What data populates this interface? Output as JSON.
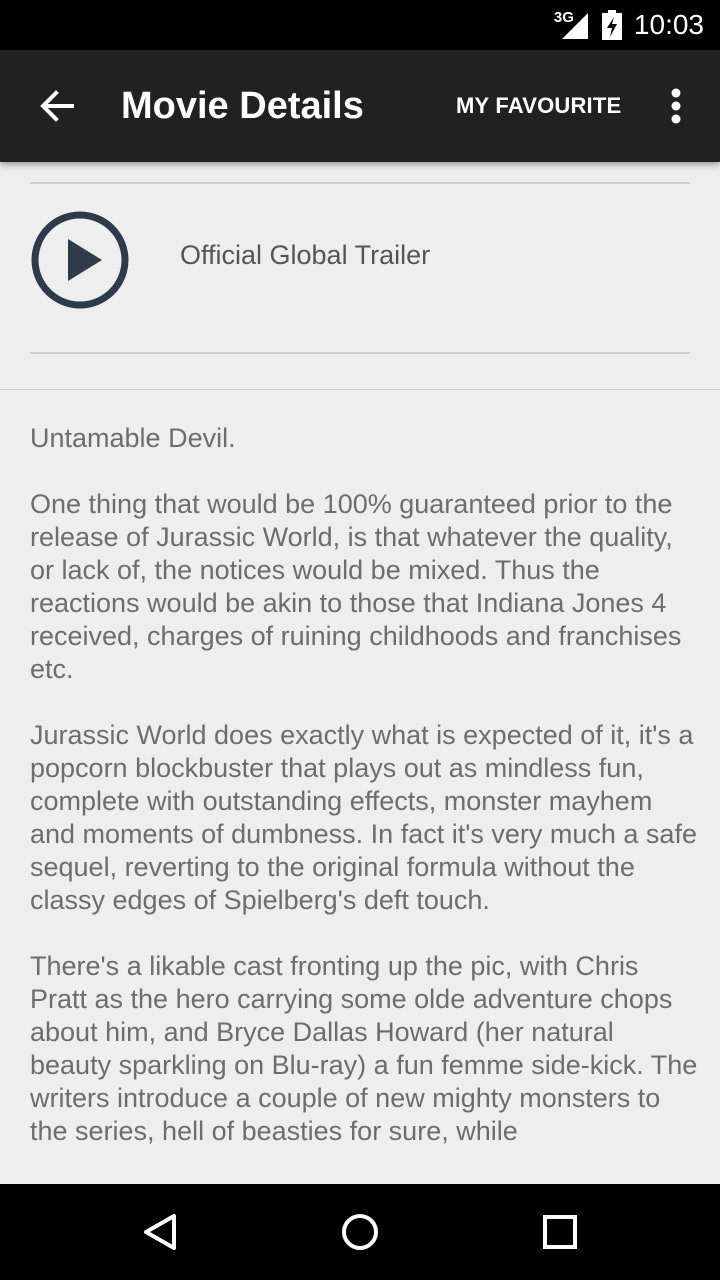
{
  "status_bar": {
    "network": "3G",
    "time": "10:03"
  },
  "app_bar": {
    "title": "Movie Details",
    "favourite_label": "MY FAVOURITE"
  },
  "trailer": {
    "label": "Official Global Trailer"
  },
  "review": {
    "paragraphs": [
      "Untamable Devil.",
      "One thing that would be 100% guaranteed prior to the release of Jurassic World, is that whatever the quality, or lack of, the notices would be mixed. Thus the reactions would be akin to those that Indiana Jones 4 received, charges of ruining childhoods and franchises etc.",
      "Jurassic World does exactly what is expected of it, it's a popcorn blockbuster that plays out as mindless fun, complete with outstanding effects, monster mayhem and moments of dumbness. In fact it's very much a safe sequel, reverting to the original formula without the classy edges of Spielberg's deft touch.",
      "There's a likable cast fronting up the pic, with Chris Pratt as the hero carrying some olde adventure chops about him, and Bryce Dallas Howard (her natural beauty sparkling on Blu-ray) a fun femme side-kick. The writers introduce a couple of new mighty monsters to the series, hell of beasties for sure, while"
    ]
  },
  "icons": {
    "back": "arrow-back-icon",
    "overflow": "more-vert-icon",
    "play": "play-circle-icon",
    "nav_back": "triangle-back-icon",
    "nav_home": "circle-home-icon",
    "nav_recents": "square-recents-icon"
  },
  "colors": {
    "app_bar": "#212121",
    "background": "#eeeeee",
    "play_icon": "#2f3a4a",
    "body_text": "#6d6d6d"
  }
}
